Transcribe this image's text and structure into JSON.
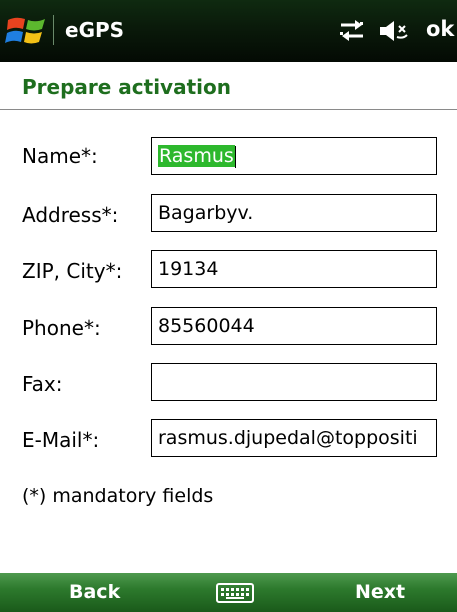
{
  "titlebar": {
    "app_title": "eGPS",
    "ok_label": "ok",
    "icons": [
      "windows-start-icon",
      "connectivity-icon",
      "speaker-muted-icon"
    ]
  },
  "page": {
    "heading": "Prepare activation"
  },
  "form": {
    "name_label": "Name*:",
    "name_value": "Rasmus",
    "address_label": "Address*:",
    "address_value": "Bagarbyv.",
    "zipcity_label": "ZIP, City*:",
    "zipcity_value": "19134",
    "phone_label": "Phone*:",
    "phone_value": "85560044",
    "fax_label": "Fax:",
    "fax_value": "",
    "email_label": "E-Mail*:",
    "email_value": "rasmus.djupedal@toppositi"
  },
  "note": "(*) mandatory fields",
  "softkeys": {
    "left": "Back",
    "right": "Next",
    "center_icon": "keyboard-icon"
  },
  "colors": {
    "heading": "#1e6e1e",
    "selection": "#2db82d",
    "softbar": "#2d7a2d",
    "titlebar": "#0a1a0a"
  }
}
